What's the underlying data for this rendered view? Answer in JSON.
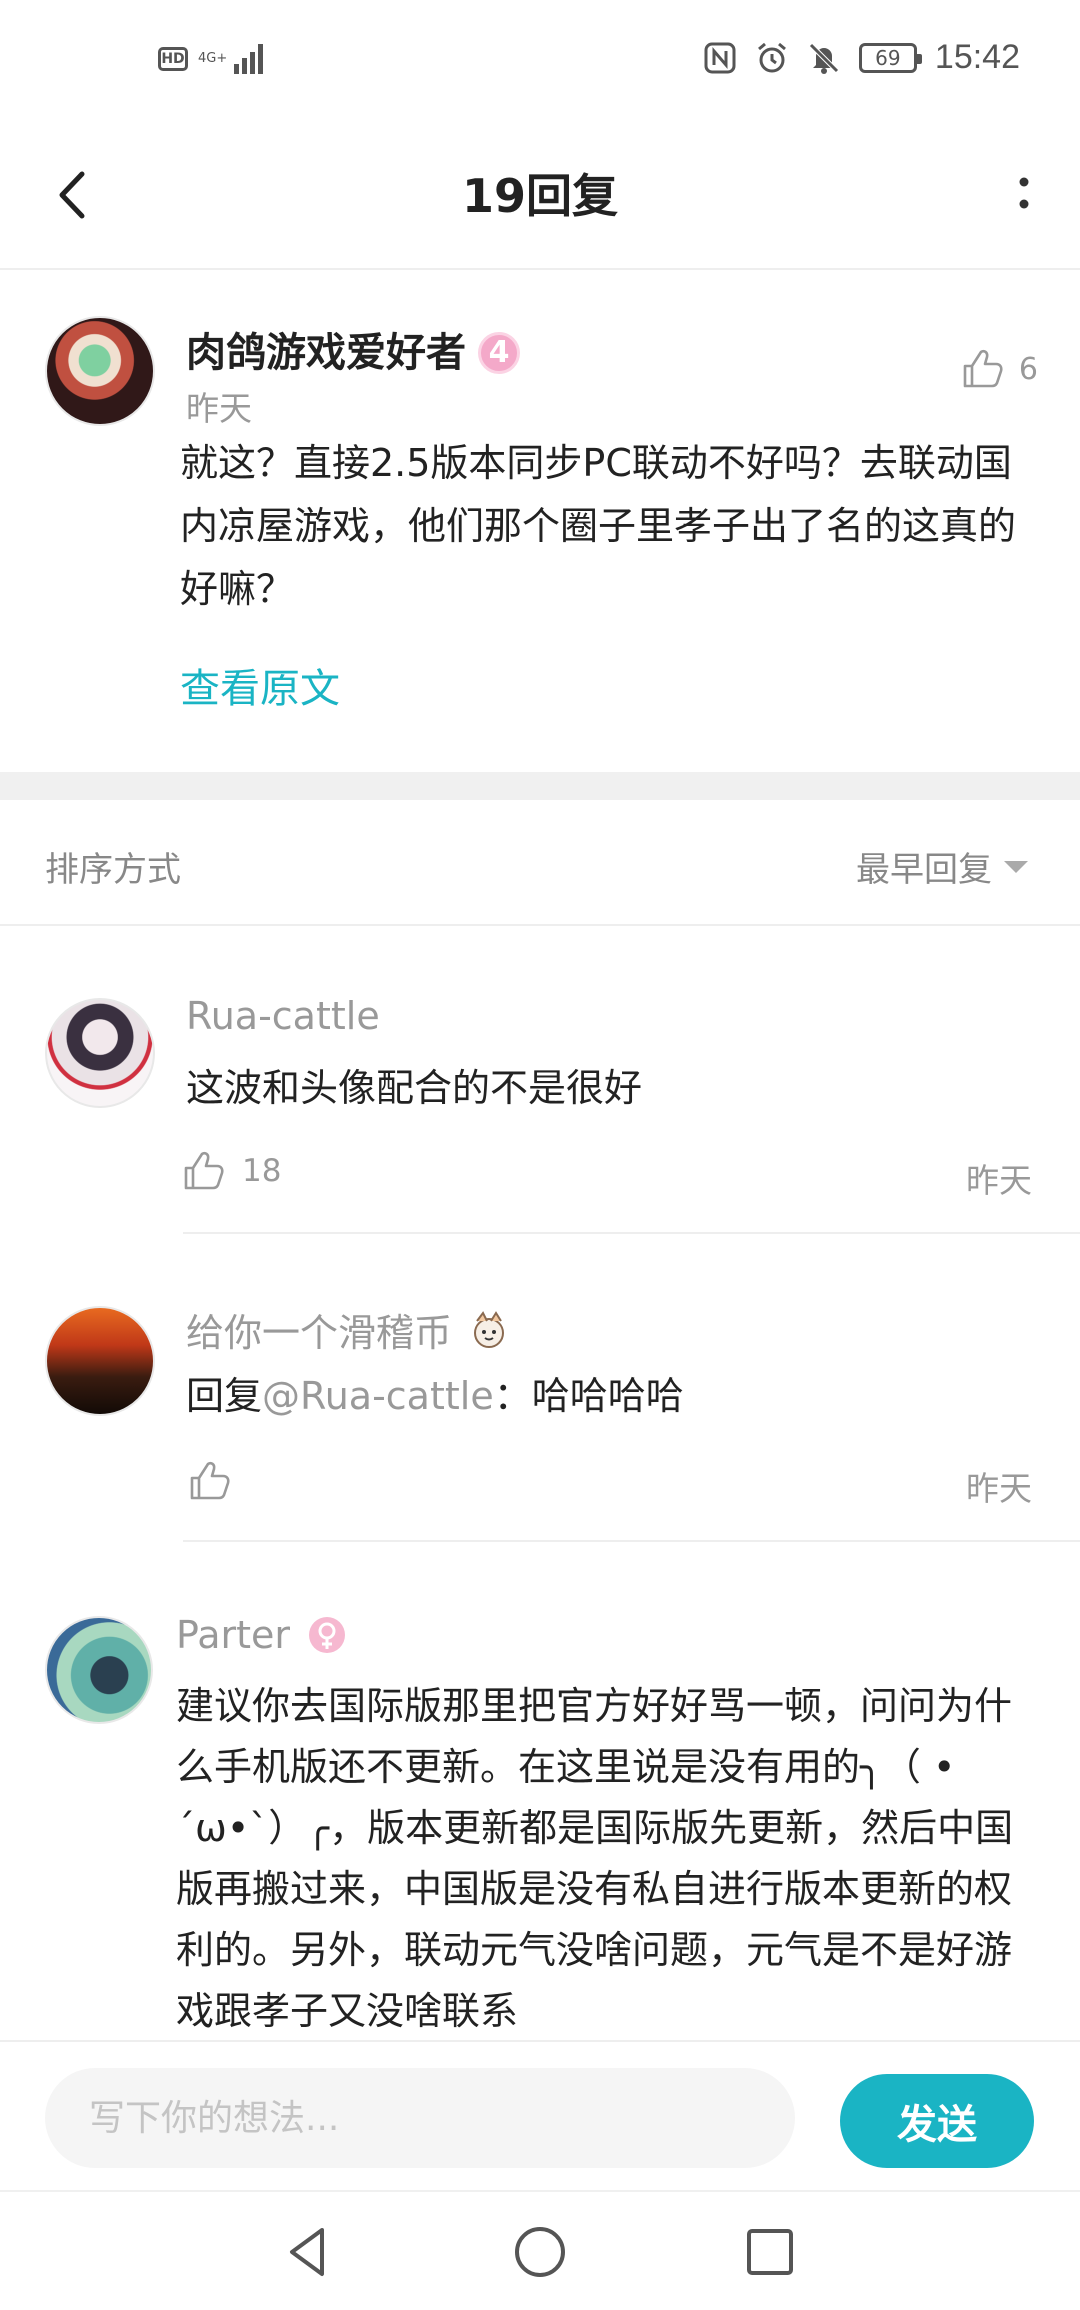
{
  "status_bar": {
    "hd_label": "HD",
    "network_label": "4G+",
    "battery_level": "69",
    "time": "15:42"
  },
  "header": {
    "title": "19回复"
  },
  "post": {
    "author": "肉鸽游戏爱好者",
    "level_badge": "4",
    "time": "昨天",
    "like_count": "6",
    "body": "就这？直接2.5版本同步PC联动不好吗？去联动国内凉屋游戏，他们那个圈子里孝子出了名的这真的好嘛？",
    "view_original_label": "查看原文"
  },
  "sort": {
    "label": "排序方式",
    "value": "最早回复"
  },
  "replies": [
    {
      "author": "Rua-cattle",
      "text": "这波和头像配合的不是很好",
      "like_count": "18",
      "time": "昨天"
    },
    {
      "author": "给你一个滑稽币",
      "reply_prefix": "回复",
      "mention": "@Rua-cattle",
      "text": "：哈哈哈哈",
      "like_count": "",
      "time": "昨天"
    },
    {
      "author": "Parter",
      "text": "建议你去国际版那里把官方好好骂一顿，问问为什么手机版还不更新。在这里说是没有用的╮（ •´ω•`）╭，版本更新都是国际版先更新，然后中国版再搬过来，中国版是没有私自进行版本更新的权利的。另外，联动元气没啥问题，元气是不是好游戏跟孝子又没啥联系"
    }
  ],
  "input": {
    "placeholder": "写下你的想法...",
    "send_label": "发送"
  },
  "colors": {
    "accent": "#1ab4c4",
    "level_badge": "#f4a9c9",
    "muted_text": "#999999"
  },
  "icons": [
    "hd-icon",
    "signal-icon",
    "nfc-icon",
    "alarm-icon",
    "mute-icon",
    "battery-icon",
    "back-icon",
    "more-icon",
    "thumbs-up-icon",
    "caret-down-icon",
    "emoji-icon",
    "gender-icon",
    "nav-back-icon",
    "nav-home-icon",
    "nav-recents-icon"
  ]
}
